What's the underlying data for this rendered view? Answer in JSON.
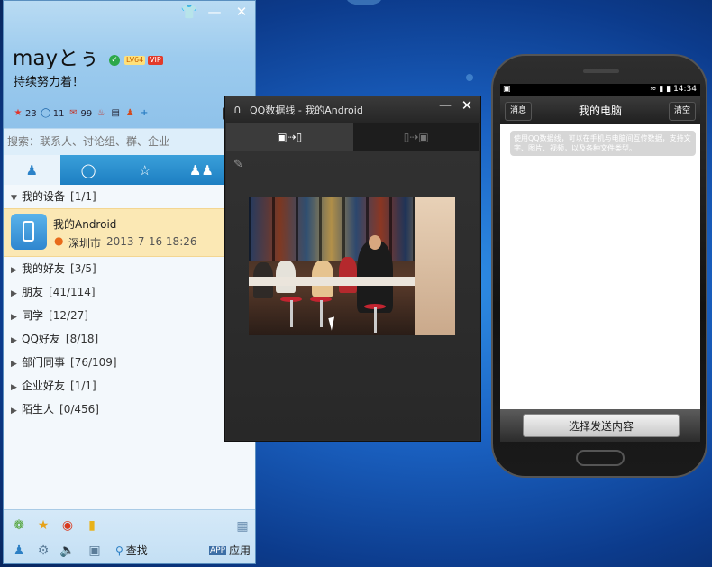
{
  "qq": {
    "nickname": "mayとぅ",
    "level_badge": "LV64",
    "vip_badge": "VIP",
    "signature": "持续努力着！",
    "stats": [
      {
        "icon": "star-icon",
        "value": "23"
      },
      {
        "icon": "bubble-icon",
        "value": "11"
      },
      {
        "icon": "mail-icon",
        "value": "99"
      },
      {
        "icon": "gift-icon",
        "value": ""
      },
      {
        "icon": "note-icon",
        "value": ""
      },
      {
        "icon": "person-icon",
        "value": ""
      },
      {
        "icon": "plus-icon",
        "value": ""
      }
    ],
    "search_placeholder": "搜索：联系人、讨论组、群、企业",
    "tabs": [
      "contacts-tab-icon",
      "recent-tab-icon",
      "star-tab-icon",
      "group-tab-icon",
      "more-tab-icon"
    ],
    "groups": [
      {
        "name": "我的设备",
        "count": "[1/1]",
        "expanded": true
      },
      {
        "name": "我的好友",
        "count": "[3/5]"
      },
      {
        "name": "朋友",
        "count": "[41/114]"
      },
      {
        "name": "同学",
        "count": "[12/27]"
      },
      {
        "name": "QQ好友",
        "count": "[8/18]"
      },
      {
        "name": "部门同事",
        "count": "[76/109]"
      },
      {
        "name": "企业好友",
        "count": "[1/1]"
      },
      {
        "name": "陌生人",
        "count": "[0/456]"
      }
    ],
    "device": {
      "name": "我的Android",
      "location": "深圳市",
      "time": "2013-7-16 18:26"
    },
    "bottom": {
      "find_label": "查找",
      "apps_label": "应用"
    }
  },
  "dataline": {
    "title": "QQ数据线 - 我的Android"
  },
  "phone": {
    "time": "14:34",
    "title": "我的电脑",
    "left_btn": "消息",
    "right_btn": "清空",
    "message": "使用QQ数据线，可以在手机与电脑间互传数据，支持文字、图片、视频，以及各种文件类型。",
    "send_button": "选择发送内容"
  }
}
